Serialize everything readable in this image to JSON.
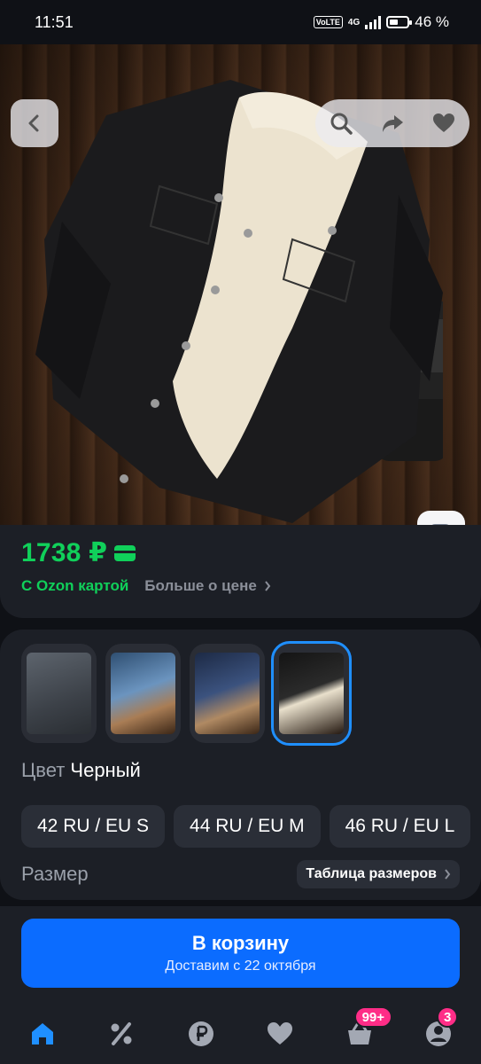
{
  "status_bar": {
    "time": "11:51",
    "network": "4G",
    "volte": "VoLTE",
    "battery": "46 %",
    "battery_level": 0.46
  },
  "hero": {
    "buttons": [
      "back-icon",
      "search-icon",
      "share-icon",
      "heart-icon",
      "image-search-icon"
    ]
  },
  "price_card": {
    "price": "1738 ₽",
    "ozon_card_label": "С Ozon картой",
    "more_price_label": "Больше о цене"
  },
  "variants": {
    "thumbnails": [
      {
        "name": "grey"
      },
      {
        "name": "light-blue"
      },
      {
        "name": "dark-blue"
      },
      {
        "name": "black",
        "selected": true
      }
    ],
    "color_label": "Цвет",
    "color_value": "Черный",
    "sizes": [
      "42 RU / EU S",
      "44 RU / EU M",
      "46 RU / EU L"
    ],
    "size_label": "Размер",
    "size_table_label": "Таблица размеров"
  },
  "cart_button": {
    "title": "В корзину",
    "subtitle": "Доставим с 22 октября"
  },
  "bottom_nav": {
    "items": [
      "home-icon",
      "percent-icon",
      "ruble-icon",
      "heart-icon",
      "cart-icon",
      "profile-icon"
    ],
    "cart_badge": "99+",
    "profile_badge": "3",
    "accent_color": "#1f8fff"
  },
  "colors": {
    "price_green": "#10d05a",
    "primary_blue": "#0b6cff",
    "badge_pink": "#ff2d87"
  }
}
